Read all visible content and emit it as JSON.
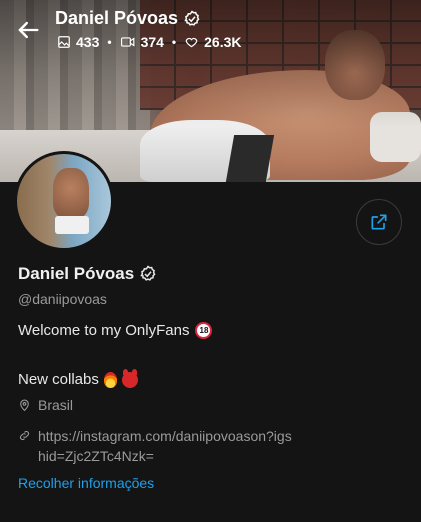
{
  "header": {
    "name": "Daniel Póvoas",
    "stats": {
      "photos": "433",
      "videos": "374",
      "likes": "26.3K"
    }
  },
  "profile": {
    "name": "Daniel Póvoas",
    "handle": "@daniipovoas",
    "bio_line1": "Welcome to my OnlyFans",
    "bio_line2": "New collabs",
    "location": "Brasil",
    "link": "https://instagram.com/daniipovoason?igshid=Zjc2ZTc4Nzk=",
    "collapse_label": "Recolher informações"
  },
  "colors": {
    "accent": "#1fa0ea",
    "background": "#141414",
    "secondary_text": "#9a9a9a"
  },
  "icons": [
    "back-arrow-icon",
    "verified-icon",
    "image-icon",
    "video-icon",
    "heart-icon",
    "share-icon",
    "location-pin-icon",
    "link-icon",
    "18-plus-icon",
    "fire-emoji",
    "devil-emoji"
  ]
}
